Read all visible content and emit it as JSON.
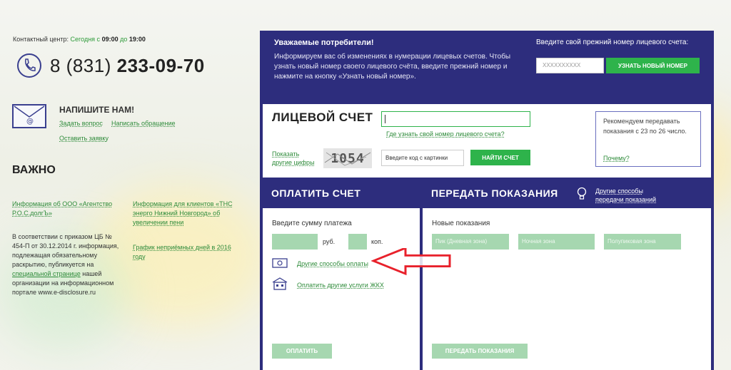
{
  "header": {
    "contact_label": "Контактный центр:",
    "hours_prefix": "Сегодня с",
    "hours_from": "09:00",
    "hours_mid": "до",
    "hours_to": "19:00",
    "phone_code": "8 (831)",
    "phone_number": "233-09-70"
  },
  "write": {
    "title": "НАПИШИТЕ НАМ!",
    "ask_question": "Задать вопрос",
    "send_appeal": "Написать обращение",
    "leave_request": "Оставить заявку"
  },
  "important": {
    "title": "ВАЖНО",
    "link1": "Информация об ООО «Агентство Р.О.С.долгЪ»",
    "link2": "Информация для клиентов «ТНС энерго Нижний Новгород» об увеличении пени",
    "link3": "График неприёмных дней в 2016 году",
    "text_before": "В соответствии с приказом ЦБ № 454-П от 30.12.2014 г. информация, подлежащая обязательному раскрытию, публикуется на",
    "text_link": "специальной странице",
    "text_after": "нашей организации на информационном портале www.e-disclosure.ru"
  },
  "notice": {
    "title": "Уважаемые потребители!",
    "body": "Информируем вас об изменениях в нумерации лицевых счетов. Чтобы узнать новый номер своего лицевого счёта, введите прежний номер и нажмите на кнопку «Узнать новый номер».",
    "old_label": "Введите свой прежний номер лицевого счета:",
    "old_placeholder": "XXXXXXXXXX",
    "find_button": "УЗНАТЬ НОВЫЙ НОМЕР"
  },
  "account": {
    "title": "ЛИЦЕВОЙ СЧЕТ",
    "how_link": "Где узнать свой номер лицевого счета?",
    "show_other": "Показать другие цифры",
    "captcha": "1054",
    "code_placeholder": "Введите код с картинки",
    "find_button": "НАЙТИ СЧЕТ",
    "reco_text": "Рекомендуем передавать показания с 23 по 26 число.",
    "why_link": "Почему?"
  },
  "pay": {
    "title": "ОПЛАТИТЬ СЧЕТ",
    "amount_label": "Введите сумму платежа",
    "rub": "руб.",
    "kop": "коп.",
    "other_methods": "Другие способы оплаты",
    "other_services": "Оплатить другие услуги ЖКХ",
    "pay_button": "ОПЛАТИТЬ"
  },
  "meter": {
    "title": "ПЕРЕДАТЬ ПОКАЗАНИЯ",
    "other_line1": "Другие способы",
    "other_line2": "передачи показаний",
    "new_label": "Новые показания",
    "peak": "Пик (Дневная зона)",
    "night": "Ночная зона",
    "half_peak": "Полупиковая зона",
    "send_button": "ПЕРЕДАТЬ ПОКАЗАНИЯ"
  },
  "colors": {
    "panel": "#2d2d7d",
    "green": "#2eb34b",
    "pale_green": "#a6d7b0",
    "arrow": "#e8212b"
  }
}
